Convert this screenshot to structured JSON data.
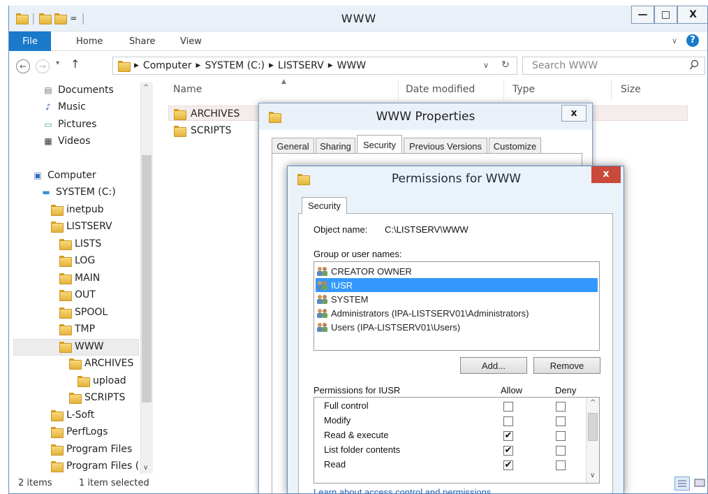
{
  "explorer": {
    "title": "WWW",
    "window_controls": {
      "minimize": "—",
      "maximize": "□",
      "close": "X"
    },
    "ribbon_tabs": [
      "File",
      "Home",
      "Share",
      "View"
    ],
    "address": {
      "parts": [
        "Computer",
        "SYSTEM (C:)",
        "LISTSERV",
        "WWW"
      ]
    },
    "search_placeholder": "Search WWW",
    "columns": [
      "Name",
      "Date modified",
      "Type",
      "Size"
    ],
    "files": [
      "ARCHIVES",
      "SCRIPTS"
    ],
    "nav_items": [
      "Documents",
      "Music",
      "Pictures",
      "Videos",
      "Computer",
      "SYSTEM (C:)",
      "inetpub",
      "LISTSERV",
      "LISTS",
      "LOG",
      "MAIN",
      "OUT",
      "SPOOL",
      "TMP",
      "WWW",
      "ARCHIVES",
      "upload",
      "SCRIPTS",
      "L-Soft",
      "PerfLogs",
      "Program Files",
      "Program Files ("
    ],
    "status": {
      "count": "2 items",
      "selected": "1 item selected"
    }
  },
  "properties": {
    "title": "WWW Properties",
    "close": "x",
    "tabs": [
      "General",
      "Sharing",
      "Security",
      "Previous Versions",
      "Customize"
    ],
    "active_tab": "Security"
  },
  "permissions": {
    "title": "Permissions for WWW",
    "close": "x",
    "tab": "Security",
    "object_label": "Object name:",
    "object_path": "C:\\LISTSERV\\WWW",
    "group_label": "Group or user names:",
    "users": [
      "CREATOR OWNER",
      "IUSR",
      "SYSTEM",
      "Administrators (IPA-LISTSERV01\\Administrators)",
      "Users (IPA-LISTSERV01\\Users)"
    ],
    "selected_user": "IUSR",
    "add_button": "Add...",
    "remove_button": "Remove",
    "perm_header": "Permissions for IUSR",
    "allow_label": "Allow",
    "deny_label": "Deny",
    "perm_rows": [
      {
        "name": "Full control",
        "allow": false,
        "deny": false
      },
      {
        "name": "Modify",
        "allow": false,
        "deny": false
      },
      {
        "name": "Read & execute",
        "allow": true,
        "deny": false
      },
      {
        "name": "List folder contents",
        "allow": true,
        "deny": false
      },
      {
        "name": "Read",
        "allow": true,
        "deny": false
      }
    ],
    "learn_link": "Learn about access control and permissions",
    "check_mark": "✔"
  },
  "colors": {
    "accent": "#1979ca",
    "selection": "#3399ff",
    "title_bg": "#eaf1f9",
    "close_red": "#c94a3a"
  }
}
